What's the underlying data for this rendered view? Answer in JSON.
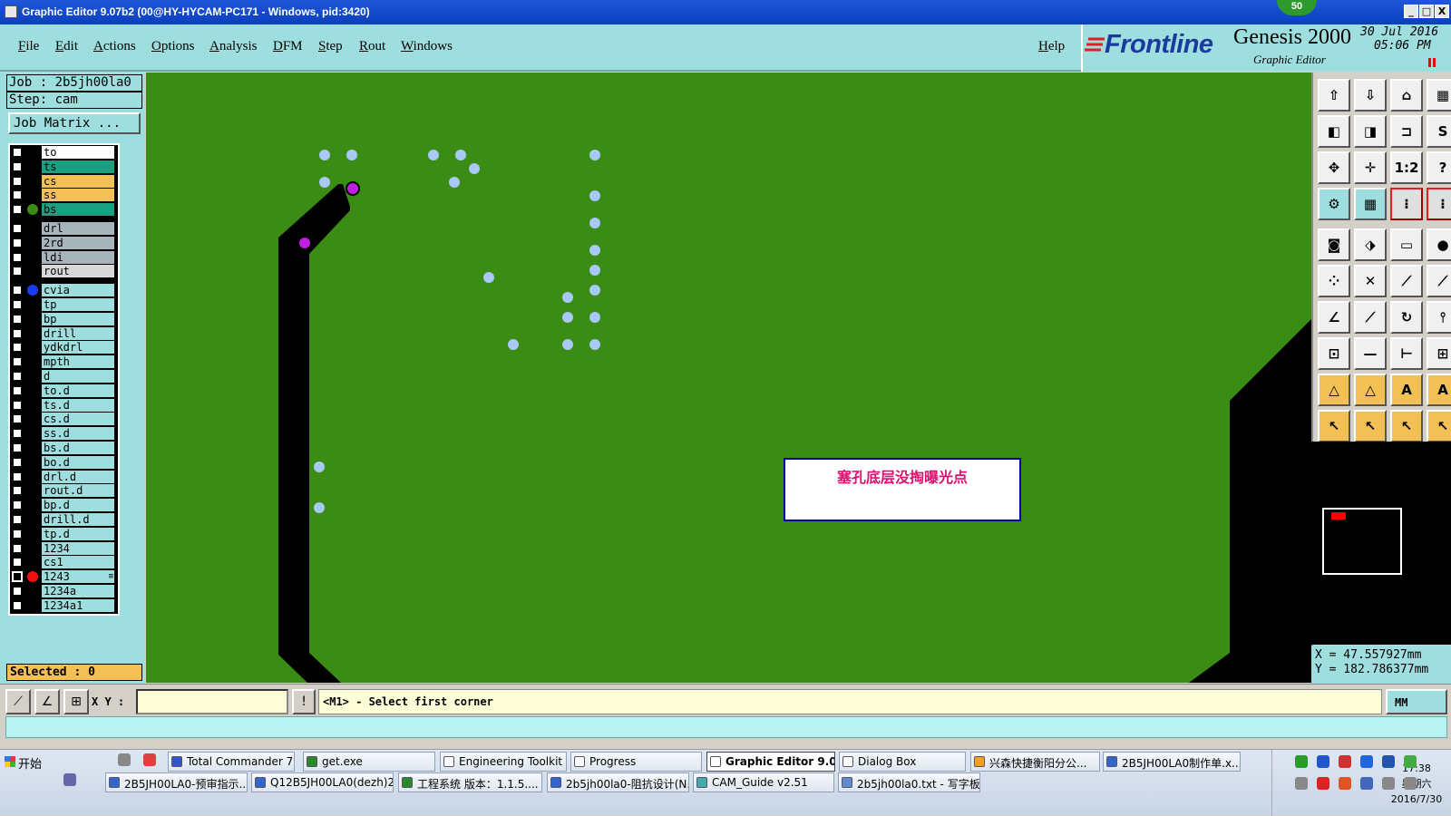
{
  "window": {
    "title": "Graphic Editor 9.07b2 (00@HY-HYCAM-PC171 - Windows, pid:3420)",
    "badge": "50",
    "min_label": "_",
    "max_label": "□",
    "close_label": "X"
  },
  "menu": {
    "items": [
      "File",
      "Edit",
      "Actions",
      "Options",
      "Analysis",
      "DFM",
      "Step",
      "Rout",
      "Windows"
    ],
    "help": "Help"
  },
  "brand": {
    "logo": "Frontline",
    "product": "Genesis 2000",
    "subtitle": "Graphic Editor",
    "date": "30 Jul 2016",
    "time": "05:06 PM"
  },
  "job": {
    "job": "Job : 2b5jh00la0",
    "step": "Step: cam",
    "matrix_button": "Job Matrix ..."
  },
  "layers": [
    {
      "name": "to",
      "color": "#ffffff",
      "dot": ""
    },
    {
      "name": "ts",
      "color": "#1aa080",
      "dot": ""
    },
    {
      "name": "cs",
      "color": "#f2c055",
      "dot": ""
    },
    {
      "name": "ss",
      "color": "#f2c055",
      "dot": ""
    },
    {
      "name": "bs",
      "color": "#1aa080",
      "dot": "#3a8c14"
    },
    {
      "name": "drl",
      "color": "#a8b4bc",
      "dot": "",
      "gap": true
    },
    {
      "name": "2rd",
      "color": "#a8b4bc",
      "dot": ""
    },
    {
      "name": "ldi",
      "color": "#a8b4bc",
      "dot": ""
    },
    {
      "name": "rout",
      "color": "#d8d8d8",
      "dot": ""
    },
    {
      "name": "cvia",
      "color": "#9edede",
      "dot": "#1a3cf0",
      "gap": true
    },
    {
      "name": "tp",
      "color": "#9edede",
      "dot": ""
    },
    {
      "name": "bp",
      "color": "#9edede",
      "dot": ""
    },
    {
      "name": "drill",
      "color": "#9edede",
      "dot": ""
    },
    {
      "name": "ydkdrl",
      "color": "#9edede",
      "dot": ""
    },
    {
      "name": "mpth",
      "color": "#9edede",
      "dot": ""
    },
    {
      "name": "d",
      "color": "#9edede",
      "dot": ""
    },
    {
      "name": "to.d",
      "color": "#9edede",
      "dot": ""
    },
    {
      "name": "ts.d",
      "color": "#9edede",
      "dot": ""
    },
    {
      "name": "cs.d",
      "color": "#9edede",
      "dot": ""
    },
    {
      "name": "ss.d",
      "color": "#9edede",
      "dot": ""
    },
    {
      "name": "bs.d",
      "color": "#9edede",
      "dot": ""
    },
    {
      "name": "bo.d",
      "color": "#9edede",
      "dot": ""
    },
    {
      "name": "drl.d",
      "color": "#9edede",
      "dot": ""
    },
    {
      "name": "rout.d",
      "color": "#9edede",
      "dot": ""
    },
    {
      "name": "bp.d",
      "color": "#9edede",
      "dot": ""
    },
    {
      "name": "drill.d",
      "color": "#9edede",
      "dot": ""
    },
    {
      "name": "tp.d",
      "color": "#9edede",
      "dot": ""
    },
    {
      "name": "1234",
      "color": "#9edede",
      "dot": ""
    },
    {
      "name": "cs1",
      "color": "#9edede",
      "dot": ""
    },
    {
      "name": "1243",
      "color": "#9edede",
      "dot": "#f01010",
      "checked": true
    },
    {
      "name": "1234a",
      "color": "#9edede",
      "dot": ""
    },
    {
      "name": "1234a1",
      "color": "#9edede",
      "dot": ""
    }
  ],
  "selected": "Selected : 0",
  "canvas": {
    "background": "#3a8c14",
    "annotation": "塞孔底层没掏曝光点"
  },
  "coords": {
    "x": "X = 47.557927mm",
    "y": "Y = 182.786377mm"
  },
  "command": {
    "xy_label": "X Y :",
    "xy_value": "",
    "prompt": "<M1> - Select first corner",
    "units": "MM"
  },
  "taskbar": {
    "start": "开始",
    "row1": [
      {
        "label": "Total Commander 7.0 ...",
        "icon": "#3355cc"
      },
      {
        "label": "get.exe",
        "icon": "#2a8a2a"
      },
      {
        "label": "Engineering Toolkit 9....",
        "icon": "#ffffff"
      },
      {
        "label": "Progress",
        "icon": "#ffffff"
      },
      {
        "label": "Graphic Editor 9.07...",
        "icon": "#ffffff",
        "active": true
      },
      {
        "label": "Dialog Box",
        "icon": "#ffffff"
      },
      {
        "label": "兴森快捷衡阳分公...",
        "icon": "#f0a020"
      },
      {
        "label": "2B5JH00LA0制作单.x...",
        "icon": "#3366cc"
      }
    ],
    "row2": [
      {
        "label": "2B5JH00LA0-预审指示....",
        "icon": "#3366cc"
      },
      {
        "label": "Q12B5JH00LA0(dezh)20...",
        "icon": "#3366cc"
      },
      {
        "label": "工程系统  版本：1.1.5....",
        "icon": "#2a8a2a"
      },
      {
        "label": "2b5jh00la0-阻抗设计(N...",
        "icon": "#3366cc"
      },
      {
        "label": "CAM_Guide v2.51",
        "icon": "#44aaaa"
      },
      {
        "label": "2b5jh00la0.txt - 写字板",
        "icon": "#6688cc"
      }
    ],
    "clock_time": "17:38",
    "clock_day": "星期六",
    "clock_date": "2016/7/30"
  }
}
